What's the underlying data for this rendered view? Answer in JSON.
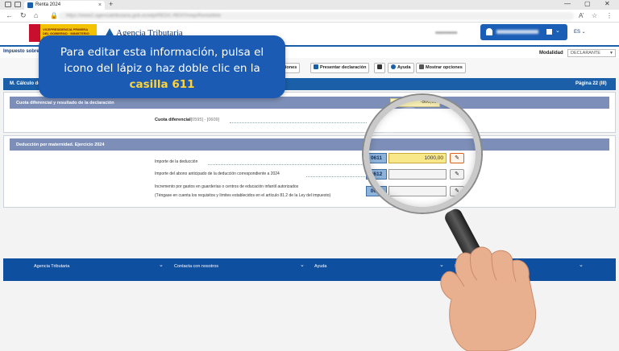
{
  "browser": {
    "tab_title": "Renta 2024",
    "tab_close": "×",
    "new_tab": "+",
    "back": "←",
    "reload": "↻",
    "home": "⌂",
    "url": "https://www2.agenciatributaria.gob.es/wlpl/REDC-RENTA/wp/RentaWeb",
    "reader_icon": "A’",
    "favorites_icon": "☆",
    "menu_icon": "⋮",
    "window_min": "—",
    "window_max": "▢",
    "window_close": "✕"
  },
  "header": {
    "gov_text": "VICEPRESIDENCIA PRIMERA DEL GOBIERNO · MINISTERIO DE HACIENDA",
    "brand": "Agencia Tributaria",
    "user_menu_chevron": "⌄",
    "lang": "ES ⌄"
  },
  "subbar": {
    "title": "Impuesto sobre la Renta",
    "modalidad_label": "Modalidad",
    "modalidad_value": "DECLARANTE"
  },
  "toolbar": {
    "buttons": [
      {
        "label": "Validar declaraciones",
        "icon": "check-icon"
      },
      {
        "label": "Presentar declaración",
        "icon": "send-icon"
      },
      {
        "label": "",
        "icon": "back-arrow-icon"
      },
      {
        "label": "Ayuda",
        "icon": "help-icon"
      },
      {
        "label": "Mostrar opciones",
        "icon": "options-icon"
      }
    ]
  },
  "section": {
    "title": "M.  Cálculo de impuesto y resultado de la autoliquidación",
    "page": "Página 22 (III)"
  },
  "cuota": {
    "header": "Cuota diferencial y resultado de la declaración",
    "label_bold": "Cuota diferencial",
    "label_ref": "[0595] - [0609]",
    "value": "-500,00"
  },
  "deduccion": {
    "header": "Deducción por maternidad. Ejercicio 2024",
    "rows": [
      {
        "label": "Importe de la deducción",
        "code": "0611",
        "value": "1000,00"
      },
      {
        "label": "Importe del abono anticipado de la deducción correspondiente a 2024",
        "code": "0612",
        "value": ""
      },
      {
        "label": "Incremento por gastos en guarderías o centros de educación infantil autorizados",
        "code": "0613",
        "value": ""
      }
    ],
    "note": "(Téngase en cuenta los requisitos y límites establecidos en el artículo 81.2 de la Ley del impuesto)"
  },
  "footer": {
    "items": [
      "Agencia Tributaria",
      "Contacta con nosotros",
      "Ayuda",
      "En"
    ]
  },
  "tooltip": {
    "line1": "Para editar esta información, pulsa el",
    "line2": "icono del lápiz o haz doble clic en la",
    "highlight": "casilla 611"
  },
  "colors": {
    "primary": "#1a5fa8",
    "subheader": "#7d8fb8",
    "active_field": "#f8e88a",
    "tooltip_bg": "#1b5bb3",
    "tooltip_highlight": "#ffd43b"
  }
}
